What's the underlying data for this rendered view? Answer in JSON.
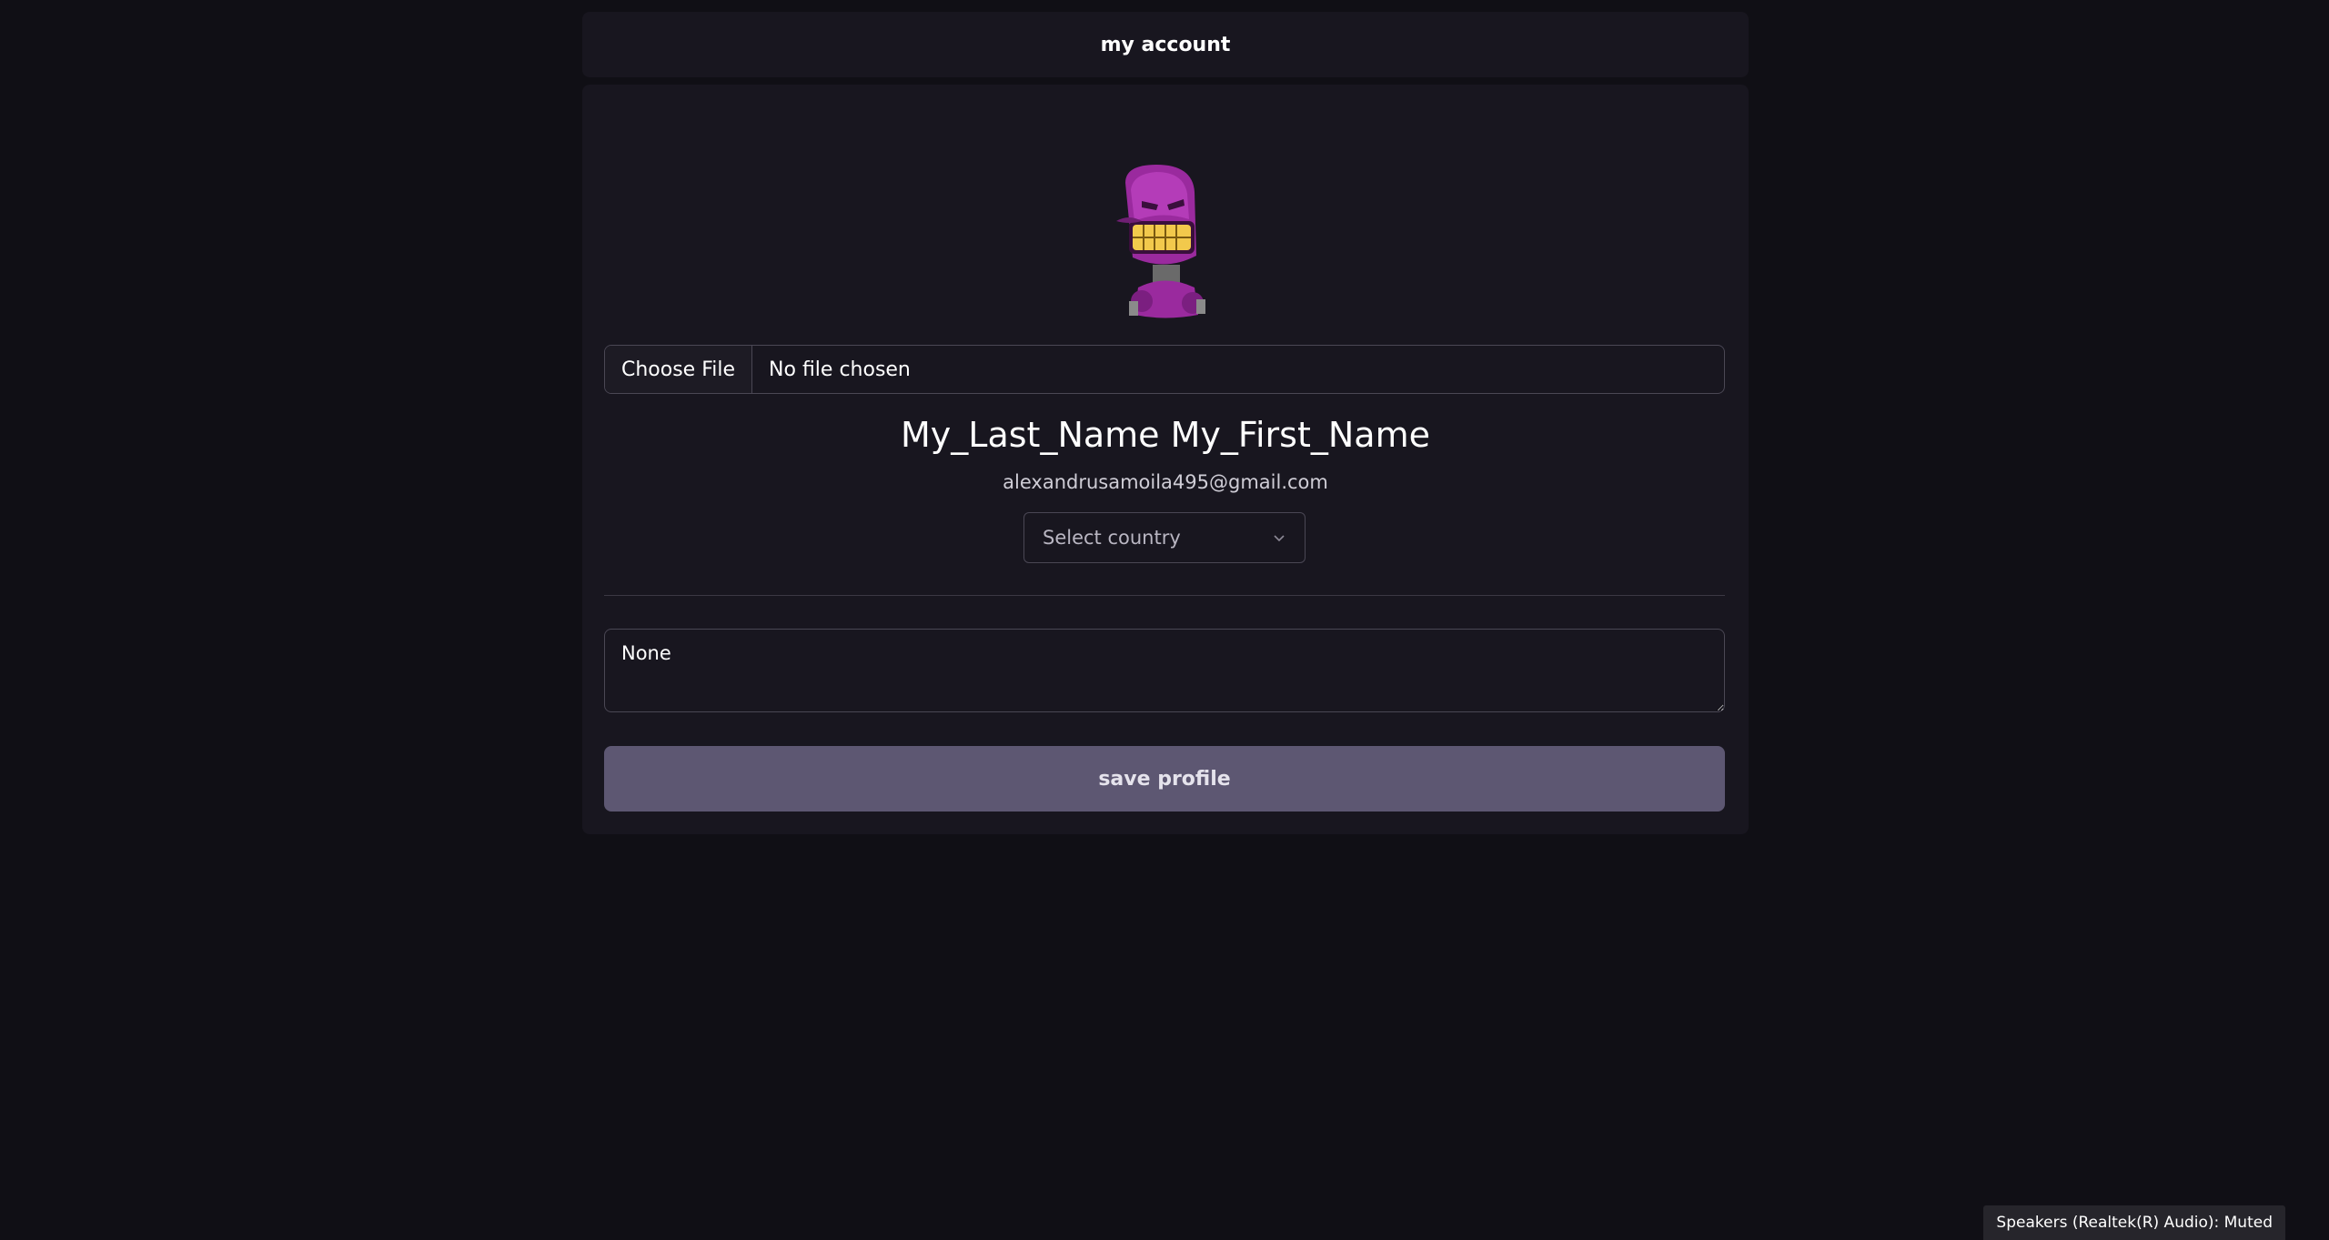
{
  "header": {
    "title": "my account"
  },
  "profile": {
    "avatar_icon": "robot-avatar-icon",
    "file_input": {
      "button_label": "Choose File",
      "status": "No file chosen"
    },
    "full_name": "My_Last_Name My_First_Name",
    "email": "alexandrusamoila495@gmail.com",
    "country_select": {
      "label": "Select country",
      "icon": "chevron-down-icon"
    },
    "bio": "None",
    "save_label": "save profile"
  },
  "system_toast": {
    "text": "Speakers (Realtek(R) Audio): Muted"
  },
  "colors": {
    "background": "#100f15",
    "card": "#18161f",
    "border": "#4a4754",
    "button": "#5d5772",
    "avatar_purple": "#9a2a9e",
    "avatar_teeth": "#f2c94c"
  }
}
